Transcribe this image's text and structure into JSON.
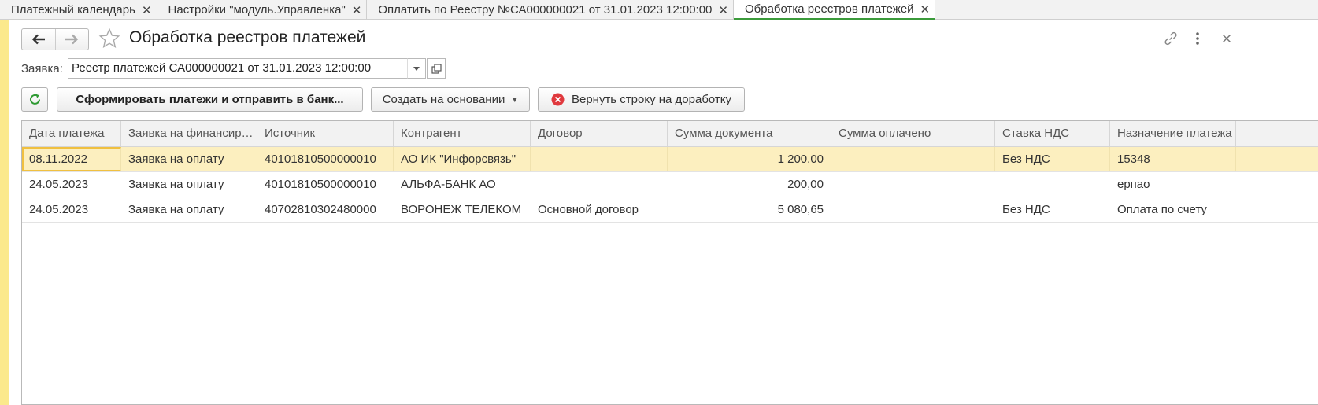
{
  "tabs": [
    {
      "label": "Платежный календарь",
      "close": "✕"
    },
    {
      "label": "Настройки \"модуль.Управленка\"",
      "close": "✕"
    },
    {
      "label": "Оплатить по Реестру №СА000000021 от 31.01.2023 12:00:00",
      "close": "✕"
    },
    {
      "label": "Обработка реестров платежей",
      "close": "✕",
      "active": true
    }
  ],
  "header": {
    "title": "Обработка реестров платежей",
    "icons": [
      "back-arrow-icon",
      "forward-arrow-icon",
      "star-icon",
      "link-icon",
      "more-icon",
      "close-icon"
    ]
  },
  "request": {
    "label": "Заявка:",
    "value": "Реестр платежей СА000000021 от 31.01.2023 12:00:00"
  },
  "toolbar": {
    "refresh_icon": "refresh-icon",
    "form_payments_label": "Сформировать платежи и отправить в банк...",
    "create_based_label": "Создать на основании",
    "return_row_label": "Вернуть строку на доработку"
  },
  "table": {
    "columns": [
      "Дата платежа",
      "Заявка на финансирование",
      "Источник",
      "Контрагент",
      "Договор",
      "Сумма документа",
      "Сумма оплачено",
      "Ставка НДС",
      "Назначение платежа"
    ],
    "rows": [
      [
        "08.11.2022",
        "Заявка на оплату",
        "40101810500000010",
        "АО ИК \"Инфорсвязь\"",
        "",
        "1 200,00",
        "",
        "Без НДС",
        "15348"
      ],
      [
        "24.05.2023",
        "Заявка на оплату",
        "40101810500000010",
        "АЛЬФА-БАНК АО",
        "",
        "200,00",
        "",
        "",
        "ерпао"
      ],
      [
        "24.05.2023",
        "Заявка на оплату",
        "40702810302480000",
        "ВОРОНЕЖ ТЕЛЕКОМ",
        "Основной договор",
        "5 080,65",
        "",
        "Без НДС",
        "Оплата по счету"
      ]
    ]
  },
  "colors": {
    "accent_green": "#3b9b3b",
    "selected_row": "#fcefbf",
    "left_strip": "#fbe98c",
    "danger": "#e0393e"
  }
}
